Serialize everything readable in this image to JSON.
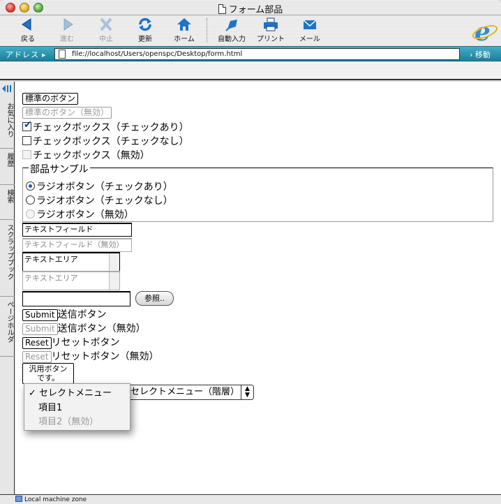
{
  "window": {
    "title": "フォーム部品"
  },
  "toolbar": {
    "buttons": [
      {
        "label": "戻る",
        "icon": "back-arrow-icon"
      },
      {
        "label": "進む",
        "icon": "forward-arrow-icon"
      },
      {
        "label": "中止",
        "icon": "stop-icon"
      },
      {
        "label": "更新",
        "icon": "refresh-icon"
      },
      {
        "label": "ホーム",
        "icon": "home-icon"
      },
      {
        "label": "自動入力",
        "icon": "autofill-icon"
      },
      {
        "label": "プリント",
        "icon": "print-icon"
      },
      {
        "label": "メール",
        "icon": "mail-icon"
      }
    ],
    "accent": "#1d74c9"
  },
  "address": {
    "label": "アドレス",
    "url": "file://localhost/Users/openspc/Desktop/form.html",
    "go": "移動"
  },
  "sidebar": {
    "tabs": [
      "お気に入り",
      "履歴",
      "検索",
      "スクラップブック",
      "ページホルダ"
    ]
  },
  "form": {
    "button_standard": "標準のボタン",
    "button_disabled": "標準のボタン（無効）",
    "checkbox_checked": "チェックボックス（チェックあり）",
    "checkbox_unchecked": "チェックボックス（チェックなし）",
    "checkbox_disabled": "チェックボックス（無効）",
    "legend": "部品サンプル",
    "radio_checked": "ラジオボタン（チェックあり）",
    "radio_unchecked": "ラジオボタン（チェックなし）",
    "radio_disabled": "ラジオボタン（無効）",
    "textfield_value": "テキストフィールド",
    "textfield_disabled_value": "テキストフィールド（無効）",
    "textarea_value": "テキストエリア",
    "textarea_disabled_value": "テキストエリア",
    "browse_label": "参照..",
    "submit_label": "Submit",
    "submit_text": "送信ボタン",
    "submit_disabled_text": "送信ボタン（無効）",
    "reset_label": "Reset",
    "reset_text": "リセットボタン",
    "reset_disabled_text": "リセットボタン（無効）",
    "generic_button_line1": "汎用ボタン",
    "generic_button_line2": "です。",
    "select_menu": {
      "options": [
        {
          "label": "セレクトメニュー",
          "selected": true,
          "disabled": false
        },
        {
          "label": "項目1",
          "selected": false,
          "disabled": false
        },
        {
          "label": "項目2（無効）",
          "selected": false,
          "disabled": true
        }
      ],
      "check_glyph": "✓"
    },
    "select_hier": "セレクトメニュー（階層）"
  },
  "status": {
    "text": "Local machine zone"
  }
}
